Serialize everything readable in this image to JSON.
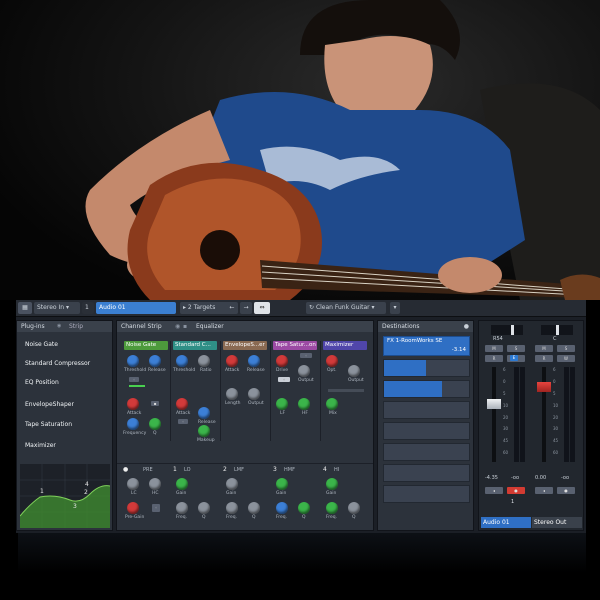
{
  "toolbar": {
    "stereo_in": "Stereo In",
    "channel_num": "1",
    "channel_name": "Audio 01",
    "targets": "2 Targets",
    "preset": "Clean Funk Guitar"
  },
  "plugins_panel": {
    "tab_plugins": "Plug-ins",
    "tab_strip": "Strip",
    "slots": [
      {
        "label": "Noise Gate",
        "color": "#5e9a4a"
      },
      {
        "label": "Standard Compressor",
        "color": "#3b8f7a"
      },
      {
        "label": "EQ Position",
        "color": "#3f72a8"
      },
      {
        "label": "EnvelopeShaper",
        "color": "#8d6d56"
      },
      {
        "label": "Tape Saturation",
        "color": "#a14fa6"
      },
      {
        "label": "Maximizer",
        "color": "#5b4cae"
      }
    ],
    "curve_labels": [
      "1",
      "2",
      "3",
      "4"
    ]
  },
  "channel_strip": {
    "tab_channel_strip": "Channel Strip",
    "tab_equalizer": "Equalizer",
    "modules": [
      {
        "title": "Noise Gate",
        "color": "#4d9a3c"
      },
      {
        "title": "Standard C...",
        "color": "#2f8f86"
      },
      {
        "title": "EnvelopeS...er",
        "color": "#8a6a52"
      },
      {
        "title": "Tape Satur...on",
        "color": "#9c4aa4"
      },
      {
        "title": "Maximizer",
        "color": "#5046aa"
      }
    ],
    "gate_labels": {
      "threshold": "Threshold",
      "release": "Release",
      "attack": "Attack",
      "frequency": "Frequency",
      "q": "Q"
    },
    "comp_labels": {
      "threshold": "Threshold",
      "ratio": "Ratio",
      "attack": "Attack",
      "release": "Release",
      "makeup": "Makeup"
    },
    "env_labels": {
      "attack": "Attack",
      "release": "Release",
      "length": "Length",
      "output": "Output"
    },
    "tape_labels": {
      "drive": "Drive",
      "output": "Output",
      "lf": "LF",
      "hf": "HF"
    },
    "max_labels": {
      "opt": "Opt.",
      "output": "Output",
      "mix": "Mix"
    },
    "eq_bands": [
      {
        "num": "",
        "name": "PRE"
      },
      {
        "num": "1",
        "name": "LO"
      },
      {
        "num": "2",
        "name": "LMF"
      },
      {
        "num": "3",
        "name": "HMF"
      },
      {
        "num": "4",
        "name": "HI"
      }
    ],
    "pre_labels": {
      "lc": "LC",
      "hc": "HC",
      "pregain": "Pre-Gain"
    },
    "band_labels": {
      "gain": "Gain",
      "freq": "Freq.",
      "q": "Q"
    }
  },
  "destinations": {
    "title": "Destinations",
    "send_name": "FX 1-RoomWorks SE",
    "send_value": "-3.14"
  },
  "mixer": {
    "ch1_pan": "R54",
    "ch2_pan": "C",
    "ch1_buttons": [
      "M",
      "S",
      "R",
      "W"
    ],
    "ch2_buttons": [
      "M",
      "S",
      "R",
      "W"
    ],
    "ch1_readouts": [
      "-4.35",
      "-oo"
    ],
    "ch2_readouts": [
      "0.00",
      "-oo"
    ],
    "fader_scale": [
      "6",
      "0",
      "5",
      "10",
      "20",
      "30",
      "45",
      "60"
    ],
    "ch1_fader_level": 0.62,
    "ch2_fader_level": 0.82,
    "ch1_num": "1",
    "ch2_num": "",
    "ch1_name": "Audio 01",
    "ch2_name": "Stereo Out",
    "e_label": "E"
  }
}
